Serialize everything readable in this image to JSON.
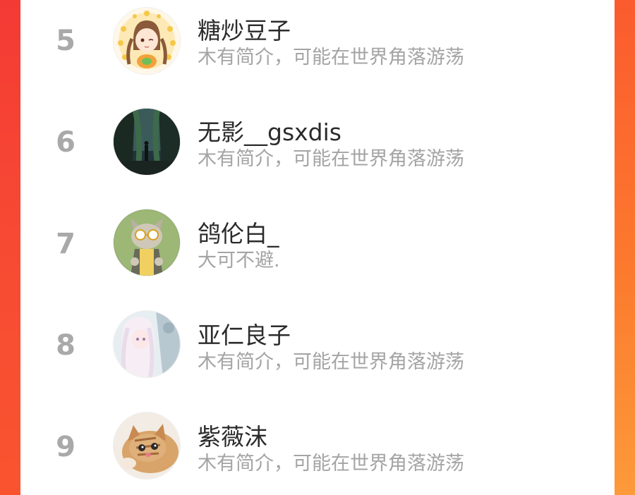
{
  "leaderboard": {
    "entries": [
      {
        "rank": "5",
        "name": "糖炒豆子",
        "bio": "木有简介，可能在世界角落游荡",
        "avatar": "anime-girl-avatar"
      },
      {
        "rank": "6",
        "name": "无影__gsxdis",
        "bio": "木有简介，可能在世界角落游荡",
        "avatar": "forest-scene-avatar"
      },
      {
        "rank": "7",
        "name": "鸽伦白_",
        "bio": "大可不避.",
        "avatar": "cartoon-cat-avatar"
      },
      {
        "rank": "8",
        "name": "亚仁良子",
        "bio": "木有简介，可能在世界角落游荡",
        "avatar": "anime-girl-white-hair-avatar"
      },
      {
        "rank": "9",
        "name": "紫薇沫",
        "bio": "木有简介，可能在世界角落游荡",
        "avatar": "kitten-avatar"
      }
    ]
  },
  "colors": {
    "accent_left": "#f43a35",
    "accent_right": "#fc7a2e",
    "rank_gray": "#a9a9a9",
    "name_dark": "#2b2b2b",
    "bio_gray": "#a4a4a4"
  }
}
